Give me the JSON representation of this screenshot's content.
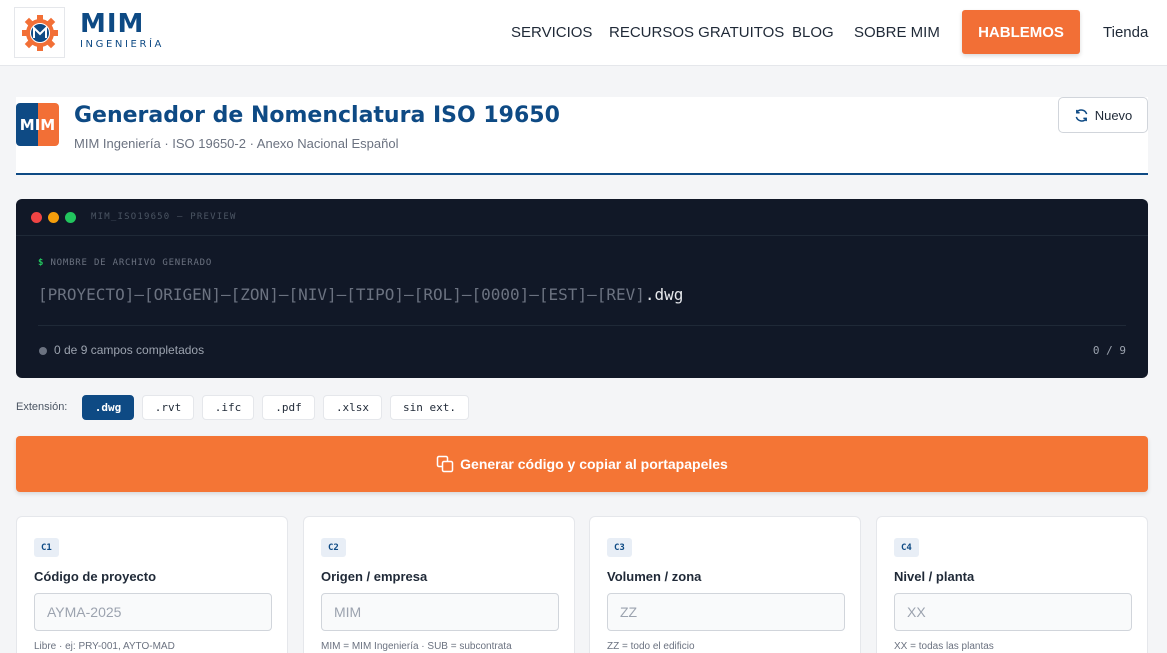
{
  "brand": {
    "name": "MIM",
    "sub": "INGENIERÍA"
  },
  "nav": {
    "items": [
      "SERVICIOS",
      "RECURSOS GRATUITOS",
      "BLOG",
      "SOBRE MIM"
    ],
    "cta": "HABLEMOS",
    "store": "Tienda"
  },
  "app": {
    "icon_text": "MIM",
    "title": "Generador de Nomenclatura ISO 19650",
    "subtitle": "MIM Ingeniería · ISO 19650-2 · Anexo Nacional Español",
    "new_button": "Nuevo"
  },
  "terminal": {
    "title": "MIM_ISO19650 — PREVIEW",
    "prompt": "$",
    "label": "NOMBRE DE ARCHIVO GENERADO",
    "code_placeholder": "[PROYECTO]–[ORIGEN]–[ZON]–[NIV]–[TIPO]–[ROL]–[0000]–[EST]–[REV]",
    "extension": ".dwg",
    "status": "0 de 9 campos completados",
    "counter": "0 / 9"
  },
  "extensions": {
    "label": "Extensión:",
    "options": [
      ".dwg",
      ".rvt",
      ".ifc",
      ".pdf",
      ".xlsx",
      "sin ext."
    ],
    "selected": ".dwg"
  },
  "generate_button": "Generar código y copiar al portapapeles",
  "fields": [
    {
      "code": "C1",
      "label": "Código de proyecto",
      "placeholder": "AYMA-2025",
      "hint": "Libre · ej: PRY-001, AYTO-MAD"
    },
    {
      "code": "C2",
      "label": "Origen / empresa",
      "placeholder": "MIM",
      "hint": "MIM = MIM Ingeniería · SUB = subcontrata"
    },
    {
      "code": "C3",
      "label": "Volumen / zona",
      "placeholder": "ZZ",
      "hint": "ZZ = todo el edificio"
    },
    {
      "code": "C4",
      "label": "Nivel / planta",
      "placeholder": "XX",
      "hint": "XX = todas las plantas"
    }
  ],
  "colors": {
    "primary": "#0e4a84",
    "accent": "#f26f36",
    "terminal_bg": "#111827"
  }
}
